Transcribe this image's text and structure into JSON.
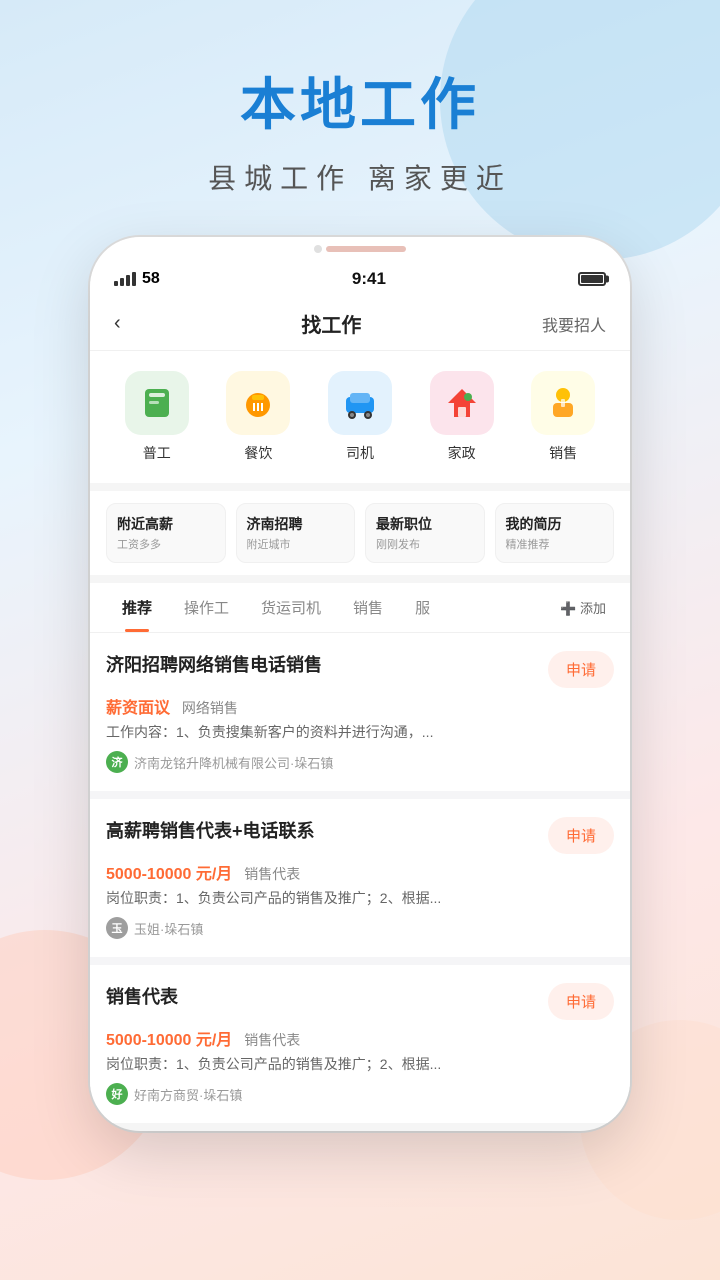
{
  "background": {
    "gradient": "linear-gradient(160deg, #d6eaf8 0%, #e8f4fd 30%, #fde8e8 70%, #fce4d6 100%)"
  },
  "header": {
    "main_title": "本地工作",
    "sub_title": "县城工作  离家更近"
  },
  "status_bar": {
    "signal": "58",
    "time": "9:41",
    "battery_label": "battery"
  },
  "nav": {
    "back_icon": "‹",
    "title": "找工作",
    "action": "我要招人"
  },
  "categories": [
    {
      "id": "general",
      "label": "普工",
      "bg": "#4caf50",
      "emoji": "👕"
    },
    {
      "id": "food",
      "label": "餐饮",
      "bg": "#ff9800",
      "emoji": "🍽"
    },
    {
      "id": "driver",
      "label": "司机",
      "bg": "#2196f3",
      "emoji": "🚗"
    },
    {
      "id": "domestic",
      "label": "家政",
      "bg": "#f44336",
      "emoji": "🏠"
    },
    {
      "id": "sales",
      "label": "销售",
      "bg": "#ffc107",
      "emoji": "👔"
    }
  ],
  "quick_links": [
    {
      "title": "附近高薪",
      "sub": "工资多多"
    },
    {
      "title": "济南招聘",
      "sub": "附近城市"
    },
    {
      "title": "最新职位",
      "sub": "刚刚发布"
    },
    {
      "title": "我的简历",
      "sub": "精准推荐"
    }
  ],
  "tabs": [
    {
      "id": "recommend",
      "label": "推荐",
      "active": true
    },
    {
      "id": "operator",
      "label": "操作工",
      "active": false
    },
    {
      "id": "freight_driver",
      "label": "货运司机",
      "active": false
    },
    {
      "id": "sales",
      "label": "销售",
      "active": false
    },
    {
      "id": "more",
      "label": "服",
      "active": false
    }
  ],
  "tab_add_label": "➕ 添加",
  "jobs": [
    {
      "id": 1,
      "title": "济阳招聘网络销售电话销售",
      "salary": "薪资面议",
      "salary_tag": "网络销售",
      "desc": "工作内容：1、负责搜集新客户的资料并进行沟通，...",
      "company": "济南龙铭升降机械有限公司·垛石镇",
      "company_color": "#4caf50",
      "company_initial": "济",
      "apply_label": "申请"
    },
    {
      "id": 2,
      "title": "高薪聘销售代表+电话联系",
      "salary": "5000-10000 元/月",
      "salary_tag": "销售代表",
      "desc": "岗位职责：1、负责公司产品的销售及推广；2、根据...",
      "company": "玉姐·垛石镇",
      "company_color": "#9e9e9e",
      "company_initial": "玉",
      "apply_label": "申请"
    },
    {
      "id": 3,
      "title": "销售代表",
      "salary": "5000-10000 元/月",
      "salary_tag": "销售代表",
      "desc": "岗位职责：1、负责公司产品的销售及推广；2、根据...",
      "company": "好南方商贸·垛石镇",
      "company_color": "#4caf50",
      "company_initial": "好",
      "apply_label": "申请"
    }
  ]
}
